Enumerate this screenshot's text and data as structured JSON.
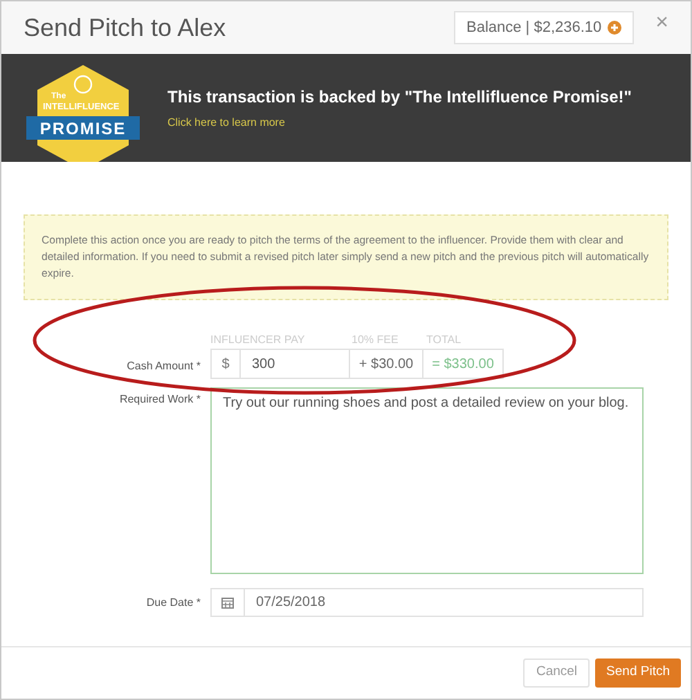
{
  "window": {
    "title": "Send Pitch to Alex",
    "balance": "Balance | $2,236.10",
    "close": "×"
  },
  "banner": {
    "badge": {
      "top": "The",
      "middle": "INTELLIFLUENCE",
      "bottom": "PROMISE"
    },
    "headline": "This transaction is backed by \"The Intellifluence Promise!\"",
    "link": "Click here to learn more"
  },
  "notice": "Complete this action once you are ready to pitch the terms of the agreement to the influencer. Provide them with clear and detailed information. If you need to submit a revised pitch later simply send a new pitch and the previous pitch will automatically expire.",
  "cash": {
    "label": "Cash Amount *",
    "pay_heading": "INFLUENCER PAY",
    "fee_heading": "10% FEE",
    "total_heading": "TOTAL",
    "currency": "$",
    "value": "300",
    "fee": "+ $30.00",
    "total": "= $330.00"
  },
  "work": {
    "label": "Required Work *",
    "value": "Try out our running shoes and post a detailed review on your blog."
  },
  "due": {
    "label": "Due Date *",
    "value": "07/25/2018"
  },
  "buttons": [
    {
      "label": "Cancel",
      "kind": "secondary"
    },
    {
      "label": "Send Pitch",
      "kind": "primary"
    }
  ]
}
